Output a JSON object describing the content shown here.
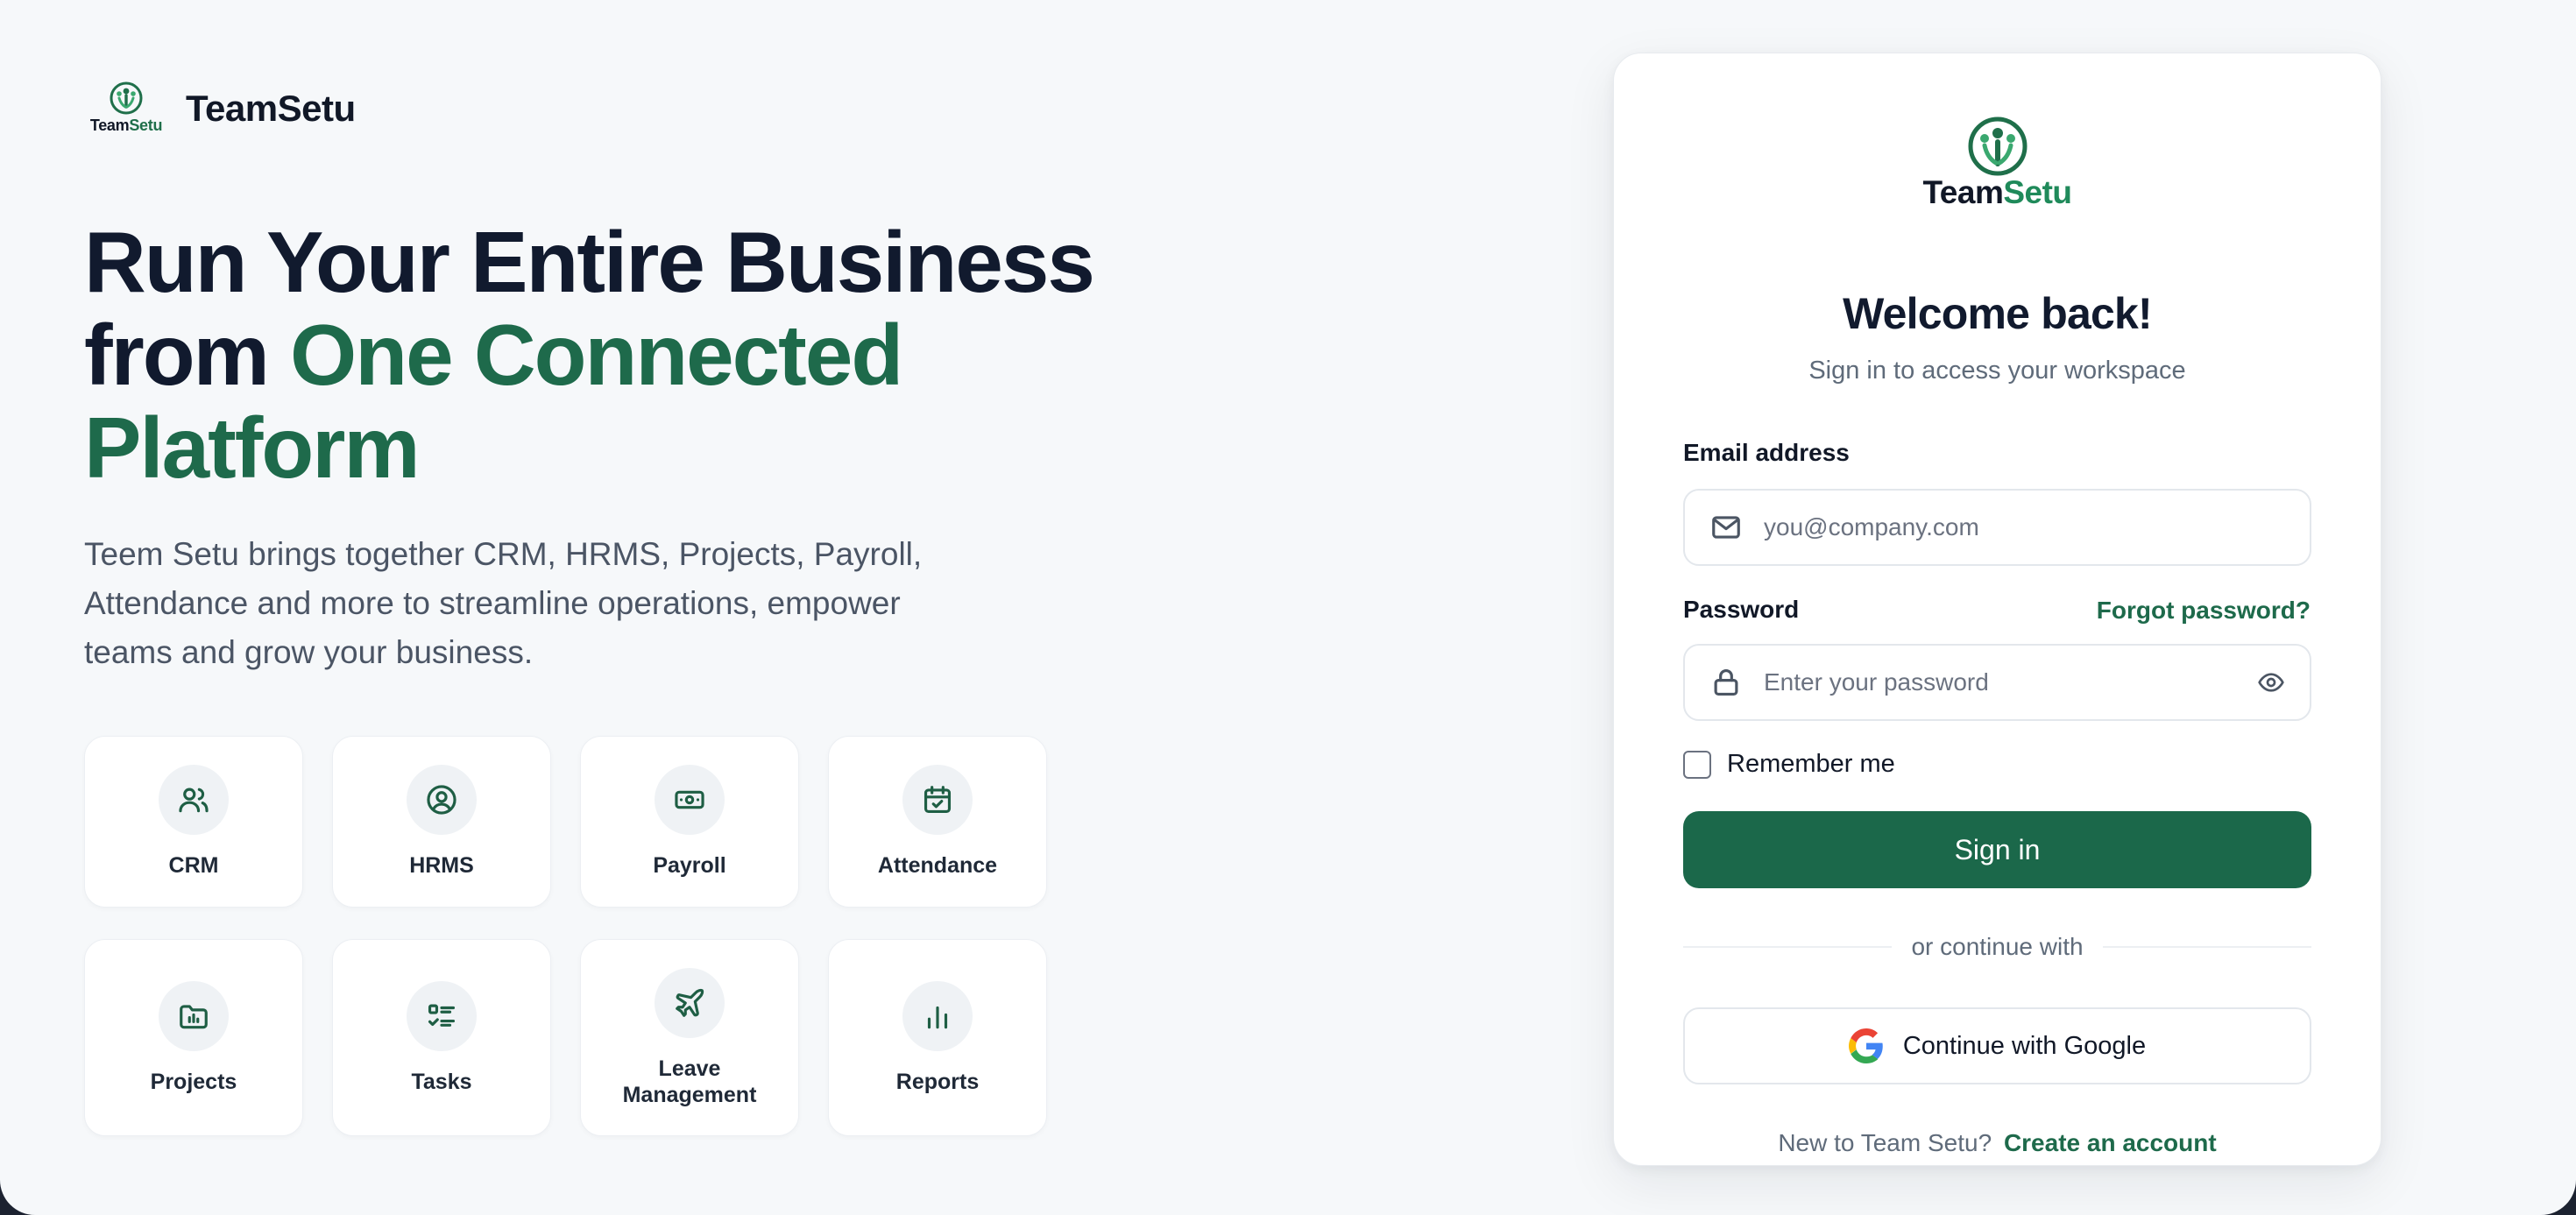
{
  "brand": {
    "name": "TeamSetu",
    "logo_word_a": "Team",
    "logo_word_b": "Setu"
  },
  "hero": {
    "headline_line1": "Run Your Entire Business",
    "headline_line2a": "from ",
    "headline_accent_a": "One Connected",
    "headline_accent_b": "Platform",
    "description": "Teem Setu brings together CRM, HRMS, Projects, Payroll, Attendance and more to streamline operations, empower teams and grow your business."
  },
  "features": [
    {
      "label": "CRM",
      "icon": "users-icon"
    },
    {
      "label": "HRMS",
      "icon": "user-circle-icon"
    },
    {
      "label": "Payroll",
      "icon": "banknote-icon"
    },
    {
      "label": "Attendance",
      "icon": "calendar-check-icon"
    },
    {
      "label": "Projects",
      "icon": "folder-icon"
    },
    {
      "label": "Tasks",
      "icon": "list-check-icon"
    },
    {
      "label": "Leave\nManagement",
      "icon": "plane-icon"
    },
    {
      "label": "Reports",
      "icon": "bar-chart-icon"
    }
  ],
  "login": {
    "logo_word_a": "Team",
    "logo_word_b": "Setu",
    "title": "Welcome back!",
    "subtitle": "Sign in to access your workspace",
    "email_label": "Email address",
    "email_placeholder": "you@company.com",
    "password_label": "Password",
    "forgot_link": "Forgot password?",
    "password_placeholder": "Enter your password",
    "remember_label": "Remember me",
    "remember_checked": false,
    "signin_button": "Sign in",
    "divider_text": "or continue with",
    "google_button": "Continue with Google",
    "signup_prompt": "New to Team Setu?",
    "signup_link": "Create an account"
  },
  "colors": {
    "accent": "#1b684a",
    "headline": "#111a2e",
    "background": "#f6f8fa"
  }
}
